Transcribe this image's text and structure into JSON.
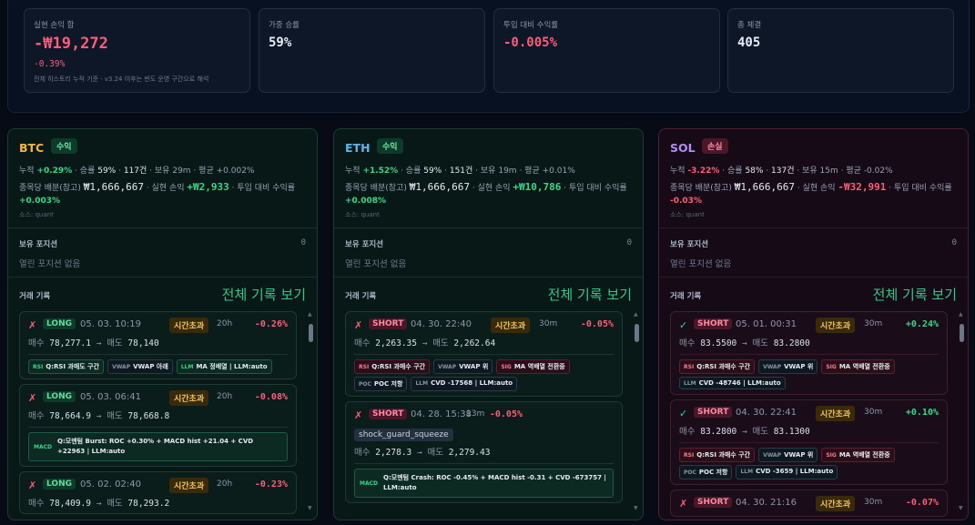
{
  "summary": {
    "realized_pnl": {
      "label": "실현 손익 합",
      "value": "-₩19,272",
      "pct": "-0.39%",
      "note": "전체 히스토리 누적 기준 · v3.24 이후는 번도 운영 구간으로 해석"
    },
    "weighted_winrate": {
      "label": "가중 승률",
      "value": "59%"
    },
    "return_on_capital": {
      "label": "투입 대비 수익률",
      "value": "-0.005%"
    },
    "total_fills": {
      "label": "총 체결",
      "value": "405"
    }
  },
  "labels": {
    "cumulative": "누적",
    "winrate": "승률",
    "hold": "보유",
    "avg": "평균",
    "alloc": "종목당 배분(참고)",
    "realized": "실현 손익",
    "roc": "투입 대비 수익률",
    "held_positions": "보유 포지션",
    "no_positions": "열린 포지션 없음",
    "trade_log": "거래 기록",
    "view_all": "전체 기록 보기"
  },
  "cards": [
    {
      "symbol": "BTC",
      "symbol_color": "#f7b733",
      "status": "수익",
      "status_type": "win",
      "cum": "+0.29%",
      "cum_type": "g",
      "winrate": "59%",
      "count": "117건",
      "hold": "29m",
      "avg": "+0.002%",
      "alloc": "₩1,666,667",
      "realized": "+₩2,933",
      "realized_type": "g",
      "roc": "+0.003%",
      "roc_type": "g",
      "source": "소스: quant",
      "held_count": "0",
      "trades": [
        {
          "ok": false,
          "mark": "✗",
          "side": "LONG",
          "side_type": "long",
          "date": "05. 03. 10:19",
          "reason": "시간초과",
          "dur": "20h",
          "pnl": "-0.26%",
          "pnl_type": "neg",
          "buy_lbl": "매수",
          "buy": "78,277.1",
          "arrow": "→",
          "sell_lbl": "매도",
          "sell": "78,140",
          "tags": [
            {
              "k": "RSI",
              "v": "Q:RSI 과매도 구간",
              "t": "rsi"
            },
            {
              "k": "VWAP",
              "v": "VWAP 아래",
              "t": ""
            },
            {
              "k": "LLM",
              "v": "MA 정배열 | LLM:auto",
              "t": "llm"
            }
          ]
        },
        {
          "ok": false,
          "mark": "✗",
          "side": "LONG",
          "side_type": "long",
          "date": "05. 03. 06:41",
          "reason": "시간초과",
          "dur": "20h",
          "pnl": "-0.08%",
          "pnl_type": "neg",
          "buy_lbl": "매수",
          "buy": "78,664.9",
          "arrow": "→",
          "sell_lbl": "매도",
          "sell": "78,668.8",
          "macd": {
            "k": "MACD",
            "v": "Q:모멘텀 Burst: ROC +0.30% + MACD hist +21.04 + CVD +22963 | LLM:auto"
          }
        },
        {
          "ok": false,
          "mark": "✗",
          "side": "LONG",
          "side_type": "long",
          "date": "05. 02. 02:40",
          "reason": "시간초과",
          "dur": "20h",
          "pnl": "-0.23%",
          "pnl_type": "neg",
          "buy_lbl": "매수",
          "buy": "78,409.9",
          "arrow": "→",
          "sell_lbl": "매도",
          "sell": "78,293.2"
        }
      ]
    },
    {
      "symbol": "ETH",
      "symbol_color": "#5ab8f0",
      "status": "수익",
      "status_type": "win",
      "cum": "+1.52%",
      "cum_type": "g",
      "winrate": "59%",
      "count": "151건",
      "hold": "19m",
      "avg": "+0.01%",
      "alloc": "₩1,666,667",
      "realized": "+₩10,786",
      "realized_type": "g",
      "roc": "+0.008%",
      "roc_type": "g",
      "source": "소스: quant",
      "held_count": "0",
      "trades": [
        {
          "ok": false,
          "mark": "✗",
          "side": "SHORT",
          "side_type": "short",
          "date": "04. 30. 22:40",
          "reason": "시간초과",
          "dur": "30m",
          "pnl": "-0.05%",
          "pnl_type": "neg",
          "buy_lbl": "매수",
          "buy": "2,263.35",
          "arrow": "→",
          "sell_lbl": "매도",
          "sell": "2,262.64",
          "tags": [
            {
              "k": "RSI",
              "v": "Q:RSI 과매수 구간",
              "t": "sig"
            },
            {
              "k": "VWAP",
              "v": "VWAP 위",
              "t": ""
            },
            {
              "k": "SIG",
              "v": "MA 역배열 전환중",
              "t": "sig"
            },
            {
              "k": "POC",
              "v": "POC 저항",
              "t": ""
            },
            {
              "k": "LLM",
              "v": "CVD -17568 | LLM:auto",
              "t": ""
            }
          ]
        },
        {
          "ok": false,
          "mark": "✗",
          "side": "SHORT",
          "side_type": "short",
          "date": "04. 28. 15:38",
          "special": "shock_guard_squeeze",
          "dur": "13m",
          "pnl": "-0.05%",
          "pnl_type": "neg",
          "buy_lbl": "매수",
          "buy": "2,278.3",
          "arrow": "→",
          "sell_lbl": "매도",
          "sell": "2,279.43",
          "macd": {
            "k": "MACD",
            "v": "Q:모멘텀 Crash: ROC -0.45% + MACD hist -0.31 + CVD -673757 | LLM:auto"
          }
        }
      ]
    },
    {
      "symbol": "SOL",
      "symbol_color": "#b48cf2",
      "status": "손실",
      "status_type": "loss",
      "cum": "-3.22%",
      "cum_type": "r",
      "winrate": "58%",
      "count": "137건",
      "hold": "15m",
      "avg": "-0.02%",
      "alloc": "₩1,666,667",
      "realized": "-₩32,991",
      "realized_type": "r",
      "roc": "-0.03%",
      "roc_type": "r",
      "source": "소스: quant",
      "held_count": "0",
      "trades": [
        {
          "ok": true,
          "mark": "✓",
          "side": "SHORT",
          "side_type": "short",
          "date": "05. 01. 00:31",
          "reason": "시간초과",
          "dur": "30m",
          "pnl": "+0.24%",
          "pnl_type": "pos",
          "buy_lbl": "매수",
          "buy": "83.5500",
          "arrow": "→",
          "sell_lbl": "매도",
          "sell": "83.2800",
          "tags": [
            {
              "k": "RSI",
              "v": "Q:RSI 과매수 구간",
              "t": "sig"
            },
            {
              "k": "VWAP",
              "v": "VWAP 위",
              "t": ""
            },
            {
              "k": "SIG",
              "v": "MA 역배열 전환중",
              "t": "sig"
            },
            {
              "k": "LLM",
              "v": "CVD -48746 | LLM:auto",
              "t": ""
            }
          ]
        },
        {
          "ok": true,
          "mark": "✓",
          "side": "SHORT",
          "side_type": "short",
          "date": "04. 30. 22:41",
          "reason": "시간초과",
          "dur": "30m",
          "pnl": "+0.10%",
          "pnl_type": "pos",
          "buy_lbl": "매수",
          "buy": "83.2800",
          "arrow": "→",
          "sell_lbl": "매도",
          "sell": "83.1300",
          "tags": [
            {
              "k": "RSI",
              "v": "Q:RSI 과매수 구간",
              "t": "sig"
            },
            {
              "k": "VWAP",
              "v": "VWAP 위",
              "t": ""
            },
            {
              "k": "SIG",
              "v": "MA 역배열 전환중",
              "t": "sig"
            },
            {
              "k": "POC",
              "v": "POC 저항",
              "t": ""
            },
            {
              "k": "LLM",
              "v": "CVD -3659 | LLM:auto",
              "t": ""
            }
          ]
        },
        {
          "ok": false,
          "mark": "✗",
          "side": "SHORT",
          "side_type": "short",
          "date": "04. 30. 21:16",
          "reason": "시간초과",
          "dur": "30m",
          "pnl": "-0.07%",
          "pnl_type": "neg"
        }
      ]
    }
  ]
}
